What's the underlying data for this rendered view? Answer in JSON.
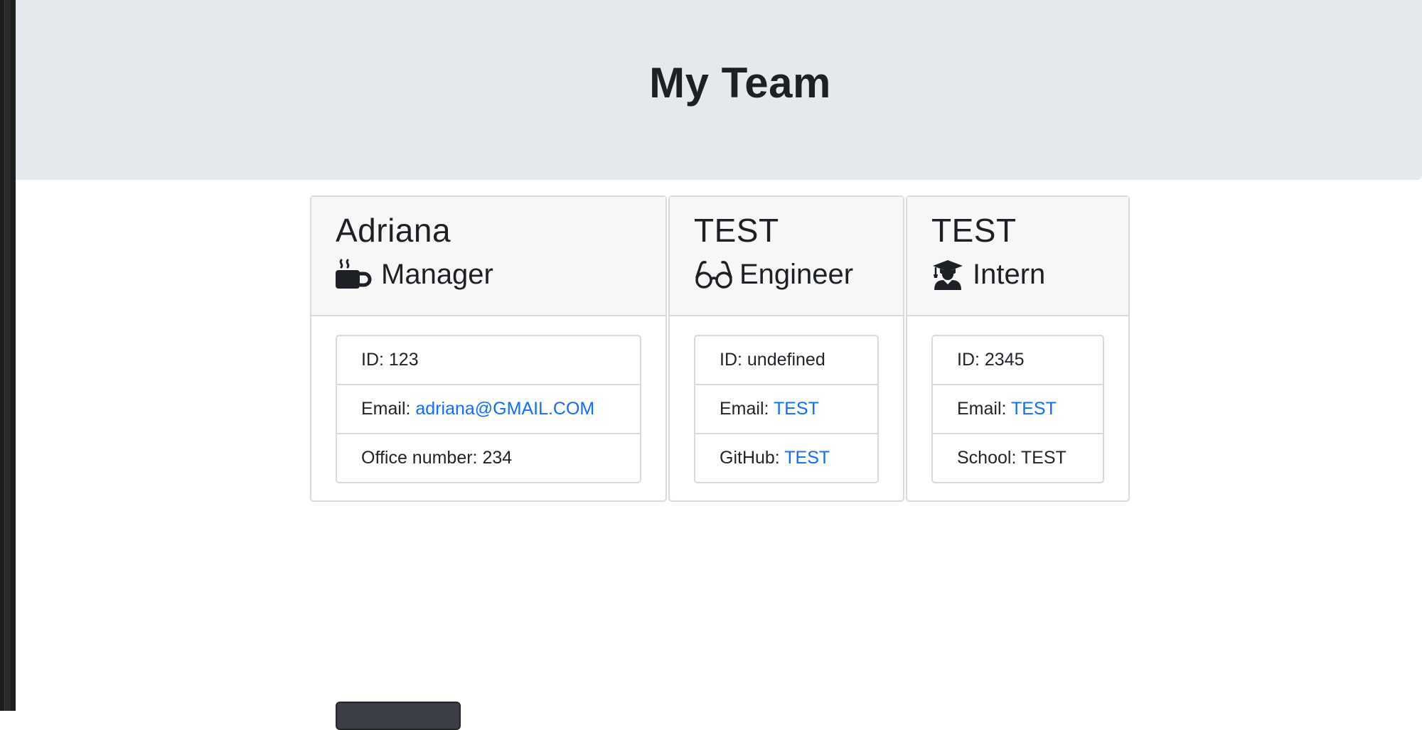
{
  "header": {
    "title": "My Team"
  },
  "cards": [
    {
      "name": "Adriana",
      "role": "Manager",
      "role_icon": "coffee-mug-icon",
      "items": [
        {
          "label": "ID: ",
          "value": "123",
          "is_link": false
        },
        {
          "label": "Email: ",
          "value": "adriana@GMAIL.COM",
          "is_link": true
        },
        {
          "label": "Office number: ",
          "value": "234",
          "is_link": false
        }
      ]
    },
    {
      "name": "TEST",
      "role": "Engineer",
      "role_icon": "glasses-icon",
      "items": [
        {
          "label": "ID: ",
          "value": "undefined",
          "is_link": false
        },
        {
          "label": "Email: ",
          "value": "TEST",
          "is_link": true
        },
        {
          "label": "GitHub: ",
          "value": "TEST",
          "is_link": true
        }
      ]
    },
    {
      "name": "TEST",
      "role": "Intern",
      "role_icon": "graduate-icon",
      "items": [
        {
          "label": "ID: ",
          "value": "2345",
          "is_link": false
        },
        {
          "label": "Email: ",
          "value": "TEST",
          "is_link": true
        },
        {
          "label": "School: ",
          "value": "TEST",
          "is_link": false
        }
      ]
    }
  ],
  "colors": {
    "link": "#0d6efd",
    "jumbotron_bg": "#e5e8ec",
    "card_header_bg": "#f7f7f7",
    "text": "#212529"
  }
}
